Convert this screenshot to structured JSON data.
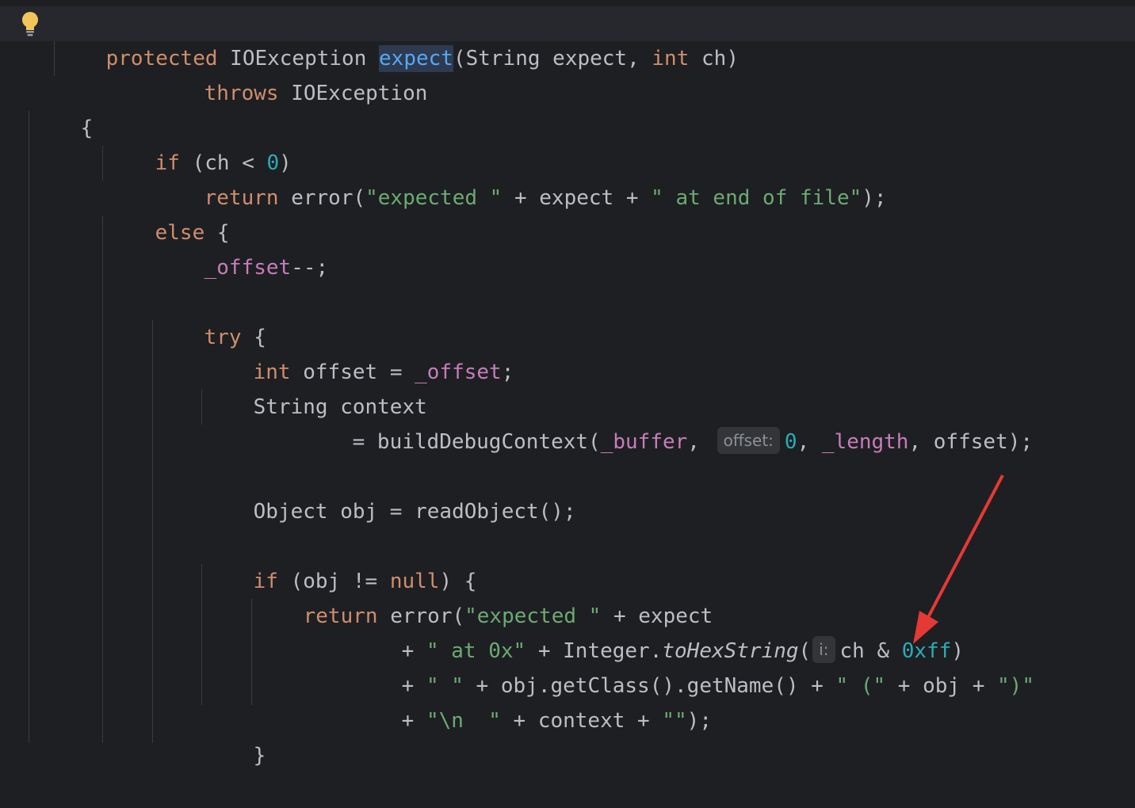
{
  "editor": {
    "colors": {
      "background": "#1e1f22",
      "keyword": "#cf8e6d",
      "field": "#c77dba",
      "string": "#6aab73",
      "number": "#2aacb8",
      "declaration": "#56a8f5",
      "text": "#bcbec4",
      "annotation_arrow": "#e53935"
    },
    "intention_icon": "lightbulb-icon",
    "annotation": "red-arrow-icon",
    "hints": {
      "offset": "offset:",
      "i": "i:"
    },
    "code": {
      "l1": {
        "protected": "protected",
        "type1": " IOException ",
        "name": "expect",
        "params_open": "(String expect, ",
        "int": "int",
        "params_close": " ch)"
      },
      "l2": {
        "throws": "throws",
        "rest": " IOException"
      },
      "l3": {
        "brace": "{"
      },
      "l4": {
        "if": "if",
        "open": " (ch < ",
        "zero": "0",
        "close": ")"
      },
      "l5": {
        "return": "return",
        "call": " error(",
        "s1": "\"expected \"",
        "mid": " + expect + ",
        "s2": "\" at end of file\"",
        "end": ");"
      },
      "l6": {
        "else": "else",
        "brace": " {"
      },
      "l7": {
        "field": "_offset",
        "rest": "--;"
      },
      "l8": {
        "try": "try",
        "brace": " {"
      },
      "l9": {
        "int": "int",
        "mid": " offset = ",
        "field": "_offset",
        "end": ";"
      },
      "l10": {
        "text": "String context"
      },
      "l11": {
        "a": "= buildDebugContext(",
        "f1": "_buffer",
        "comma": ", ",
        "zero": "0",
        "sep": ", ",
        "f2": "_length",
        "end": ", offset);"
      },
      "l12": {
        "text": "Object obj = readObject();"
      },
      "l13": {
        "if": "if",
        "open": " (obj != ",
        "null": "null",
        "close": ") {"
      },
      "l14": {
        "return": "return",
        "call": " error(",
        "s1": "\"expected \"",
        "rest": " + expect"
      },
      "l15": {
        "plus": "+ ",
        "s1": "\" at 0x\"",
        "mid": " + Integer.",
        "method": "toHexString",
        "paren": "(",
        "arg": "ch & ",
        "hex": "0xff",
        "close": ")"
      },
      "l16": {
        "plus": "+ ",
        "s1": "\" \"",
        "mid": " + obj.getClass().getName() + ",
        "s2": "\" (\"",
        "mid2": " + obj + ",
        "s3": "\")\""
      },
      "l17": {
        "plus": "+ ",
        "s1": "\"\\n  \"",
        "mid": " + context + ",
        "s2": "\"\"",
        "end": ");"
      },
      "l18": {
        "brace": "}"
      }
    }
  }
}
